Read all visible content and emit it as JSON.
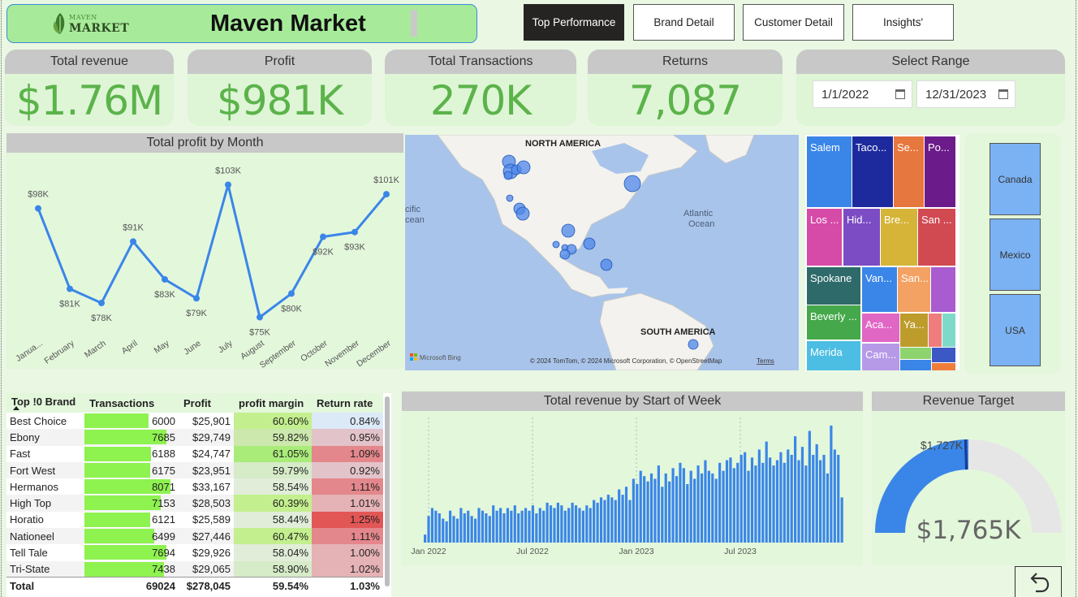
{
  "app": {
    "logo_line1": "MAVEN",
    "logo_line2": "MARKET",
    "title": "Maven Market"
  },
  "nav": [
    {
      "label": "Top Performance",
      "active": true
    },
    {
      "label": "Brand Detail",
      "active": false
    },
    {
      "label": "Customer Detail",
      "active": false
    },
    {
      "label": "Insights'",
      "active": false
    }
  ],
  "kpis": [
    {
      "label": "Total revenue",
      "value": "$1.76M"
    },
    {
      "label": "Profit",
      "value": "$981K"
    },
    {
      "label": "Total Transactions",
      "value": "270K"
    },
    {
      "label": "Returns",
      "value": "7,087"
    }
  ],
  "range": {
    "label": "Select Range",
    "start": "1/1/2022",
    "end": "12/31/2023"
  },
  "profit_chart": {
    "title": "Total profit by Month",
    "months": [
      "Janua...",
      "February",
      "March",
      "April",
      "May",
      "June",
      "July",
      "August",
      "September",
      "October",
      "November",
      "December"
    ],
    "values": [
      98,
      81,
      78,
      91,
      83,
      79,
      103,
      75,
      80,
      92,
      93,
      101
    ],
    "labels": [
      "$98K",
      "$81K",
      "$78K",
      "$91K",
      "$83K",
      "$79K",
      "$103K",
      "$75K",
      "$80K",
      "$92K",
      "$93K",
      "$101K"
    ],
    "color": "#3a86e8"
  },
  "map": {
    "label_na": "NORTH AMERICA",
    "label_sa": "SOUTH AMERICA",
    "label_atlantic1": "Atlantic",
    "label_atlantic2": "Ocean",
    "label_pacific1": "cific",
    "label_pacific2": "cean",
    "bing": "Microsoft Bing",
    "credits": "© 2024 TomTom, © 2024 Microsoft Corporation, © OpenStreetMap",
    "terms": "Terms"
  },
  "treemap": {
    "tiles": [
      {
        "label": "Salem",
        "color": "#3a86e8"
      },
      {
        "label": "Taco...",
        "color": "#1d2a9e"
      },
      {
        "label": "Se...",
        "color": "#e6773e"
      },
      {
        "label": "Po...",
        "color": "#6b1b8a"
      },
      {
        "label": "Los ...",
        "color": "#d64aa8"
      },
      {
        "label": "Hid...",
        "color": "#7b4cc4"
      },
      {
        "label": "Bre...",
        "color": "#d5b438"
      },
      {
        "label": "San ...",
        "color": "#d14a52"
      },
      {
        "label": "Spokane",
        "color": "#2f6a6a"
      },
      {
        "label": "Van...",
        "color": "#3a86e8"
      },
      {
        "label": "San...",
        "color": "#f3a264"
      },
      {
        "label": "",
        "color": "#a85cd0"
      },
      {
        "label": "Beverly ...",
        "color": "#45a84a"
      },
      {
        "label": "Aca...",
        "color": "#e067c4"
      },
      {
        "label": "Ya...",
        "color": "#bd9c2c"
      },
      {
        "label": "",
        "color": "#f07d7d"
      },
      {
        "label": "",
        "color": "#7fd9c9"
      },
      {
        "label": "Merida",
        "color": "#4cbde3"
      },
      {
        "label": "Cam...",
        "color": "#b69ae8"
      },
      {
        "label": "",
        "color": "#8ed46e"
      },
      {
        "label": "",
        "color": "#3b58c4"
      },
      {
        "label": "",
        "color": "#3a86e8"
      },
      {
        "label": "",
        "color": "#f07d3a"
      }
    ]
  },
  "countries": [
    {
      "label": "Canada"
    },
    {
      "label": "Mexico"
    },
    {
      "label": "USA"
    }
  ],
  "brand_table": {
    "headers": [
      "Top !0 Brand",
      "Transactions",
      "Profit",
      "profit margin",
      "Return rate"
    ],
    "rows": [
      {
        "brand": "Best Choice",
        "transactions": "6000",
        "t": 6000,
        "profit": "$25,901",
        "margin": "60.60%",
        "m": 60.6,
        "ret": "0.84%",
        "r": 0.84
      },
      {
        "brand": "Ebony",
        "transactions": "7685",
        "t": 7685,
        "profit": "$29,749",
        "margin": "59.82%",
        "m": 59.82,
        "ret": "0.95%",
        "r": 0.95
      },
      {
        "brand": "Fast",
        "transactions": "6188",
        "t": 6188,
        "profit": "$24,747",
        "margin": "61.05%",
        "m": 61.05,
        "ret": "1.09%",
        "r": 1.09
      },
      {
        "brand": "Fort West",
        "transactions": "6175",
        "t": 6175,
        "profit": "$23,951",
        "margin": "59.79%",
        "m": 59.79,
        "ret": "0.92%",
        "r": 0.92
      },
      {
        "brand": "Hermanos",
        "transactions": "8071",
        "t": 8071,
        "profit": "$33,167",
        "margin": "58.54%",
        "m": 58.54,
        "ret": "1.11%",
        "r": 1.11
      },
      {
        "brand": "High Top",
        "transactions": "7153",
        "t": 7153,
        "profit": "$28,503",
        "margin": "60.39%",
        "m": 60.39,
        "ret": "1.01%",
        "r": 1.01
      },
      {
        "brand": "Horatio",
        "transactions": "6121",
        "t": 6121,
        "profit": "$25,589",
        "margin": "58.44%",
        "m": 58.44,
        "ret": "1.25%",
        "r": 1.25
      },
      {
        "brand": "Nationeel",
        "transactions": "6499",
        "t": 6499,
        "profit": "$27,446",
        "margin": "60.47%",
        "m": 60.47,
        "ret": "1.11%",
        "r": 1.11
      },
      {
        "brand": "Tell Tale",
        "transactions": "7694",
        "t": 7694,
        "profit": "$29,926",
        "margin": "58.04%",
        "m": 58.04,
        "ret": "1.00%",
        "r": 1.0
      },
      {
        "brand": "Tri-State",
        "transactions": "7438",
        "t": 7438,
        "profit": "$29,065",
        "margin": "58.90%",
        "m": 58.9,
        "ret": "1.02%",
        "r": 1.02
      }
    ],
    "total": {
      "label": "Total",
      "transactions": "69024",
      "profit": "$278,045",
      "margin": "59.54%",
      "ret": "1.03%"
    }
  },
  "weekly_chart": {
    "title": "Total revenue by Start of Week",
    "ticks": [
      "Jan 2022",
      "Jul 2022",
      "Jan 2023",
      "Jul 2023"
    ],
    "values": [
      3,
      10,
      13,
      12,
      11,
      9,
      8,
      12,
      10,
      9,
      13,
      11,
      12,
      10,
      9,
      13,
      12,
      11,
      10,
      14,
      12,
      13,
      11,
      13,
      12,
      14,
      11,
      12,
      13,
      12,
      14,
      11,
      13,
      12,
      15,
      14,
      13,
      15,
      14,
      12,
      13,
      15,
      14,
      13,
      12,
      14,
      13,
      16,
      15,
      17,
      16,
      18,
      17,
      16,
      20,
      18,
      21,
      16,
      24,
      22,
      27,
      25,
      23,
      26,
      24,
      29,
      21,
      26,
      23,
      28,
      25,
      30,
      28,
      22,
      27,
      24,
      29,
      26,
      31,
      27,
      26,
      24,
      30,
      27,
      31,
      32,
      28,
      30,
      33,
      34,
      27,
      32,
      29,
      35,
      30,
      38,
      32,
      29,
      31,
      34,
      30,
      35,
      33,
      40,
      31,
      36,
      29,
      42,
      33,
      37,
      31,
      33,
      26,
      44,
      35,
      33,
      17
    ],
    "color": "#3a86e8"
  },
  "gauge": {
    "title": "Revenue Target",
    "target_label": "$1,727K",
    "value_label": "$1,765K",
    "fraction": 0.5,
    "fill_color": "#3a86e8",
    "track_color": "#e6e6e6"
  }
}
